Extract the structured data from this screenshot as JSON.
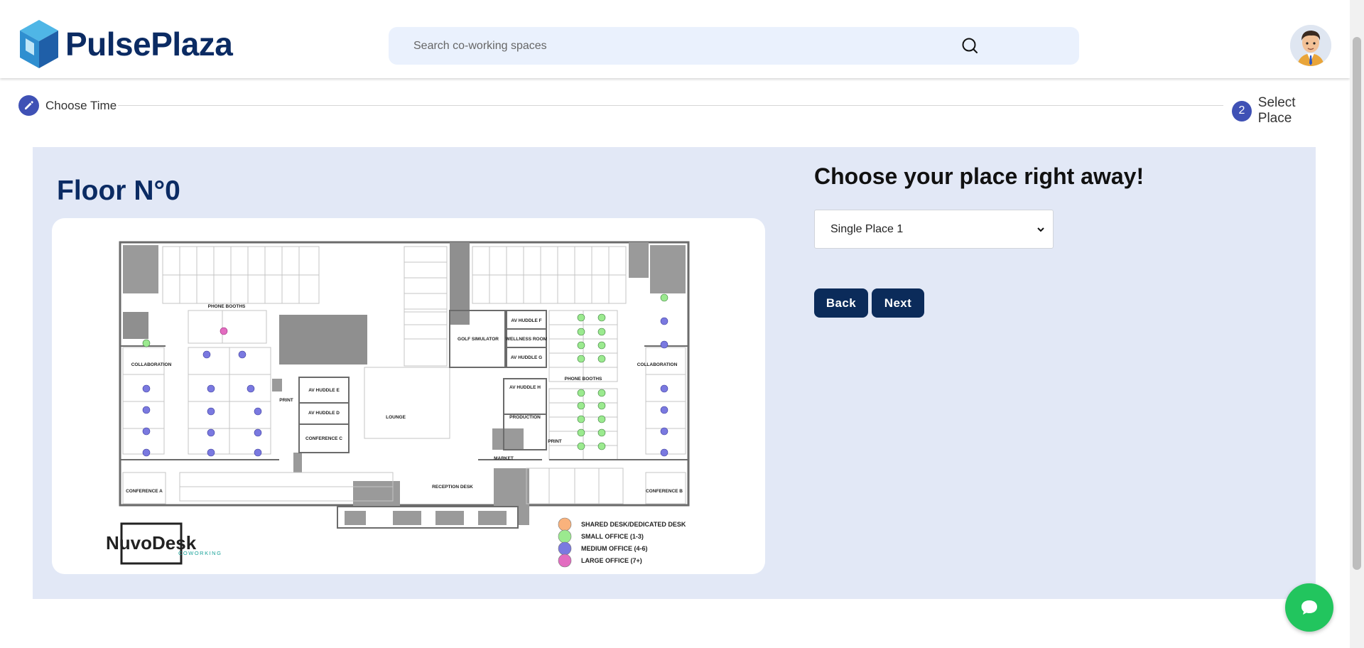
{
  "header": {
    "brand": "PulsePlaza",
    "search_placeholder": "Search co-working spaces"
  },
  "stepper": {
    "step1": {
      "label": "Choose Time",
      "icon": "pencil-icon"
    },
    "step2": {
      "number": "2",
      "label": "Select Place"
    }
  },
  "floor": {
    "title": "Floor N°0",
    "plan": {
      "brand_main": "NuvoDesk",
      "brand_sub": "COWORKING",
      "legend": [
        {
          "label": "SHARED DESK/DEDICATED DESK",
          "color": "#f9b27c"
        },
        {
          "label": "SMALL OFFICE (1-3)",
          "color": "#9bea8f"
        },
        {
          "label": "MEDIUM OFFICE (4-6)",
          "color": "#7a79e0"
        },
        {
          "label": "LARGE OFFICE (7+)",
          "color": "#e26cc0"
        }
      ],
      "room_labels": {
        "phone_booths_left": "PHONE BOOTHS",
        "phone_booths_right": "PHONE BOOTHS",
        "collaboration_left": "COLLABORATION",
        "collaboration_right": "COLLABORATION",
        "golf": "GOLF SIMULATOR",
        "av_f": "AV HUDDLE F",
        "wellness": "WELLNESS ROOM",
        "av_g": "AV HUDDLE G",
        "av_h": "AV HUDDLE H",
        "av_e": "AV HUDDLE E",
        "av_d": "AV HUDDLE D",
        "conf_c": "CONFERENCE C",
        "print_left": "PRINT",
        "print_right": "PRINT",
        "lounge": "LOUNGE",
        "production": "PRODUCTION",
        "market": "MARKET",
        "reception": "RECEPTION DESK",
        "conf_a": "CONFERENCE A",
        "conf_b": "CONFERENCE B"
      }
    }
  },
  "booking": {
    "title": "Choose your place right away!",
    "select_value": "Single Place 1",
    "options": [
      "Single Place 1"
    ],
    "back_label": "Back",
    "next_label": "Next"
  },
  "colors": {
    "brand_navy": "#0b2b63",
    "button_navy": "#0b2b5a",
    "step_accent": "#3f51b5",
    "panel_bg": "#e2e8f6",
    "chat_green": "#22c55e"
  }
}
